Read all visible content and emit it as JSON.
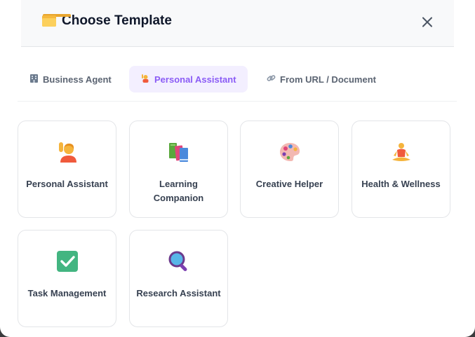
{
  "dialog": {
    "title": "Choose Template",
    "title_icon": "folder-icon",
    "close_icon": "close-icon"
  },
  "tabs": [
    {
      "label": "Business Agent",
      "icon": "office-building-icon",
      "active": false
    },
    {
      "label": "Personal Assistant",
      "icon": "raising-hand-icon",
      "active": true
    },
    {
      "label": "From URL / Document",
      "icon": "link-icon",
      "active": false
    }
  ],
  "templates": [
    {
      "label": "Personal Assistant",
      "icon": "raising-hand-person-icon"
    },
    {
      "label": "Learning Companion",
      "icon": "books-icon"
    },
    {
      "label": "Creative Helper",
      "icon": "artist-palette-icon"
    },
    {
      "label": "Health & Wellness",
      "icon": "meditation-person-icon"
    },
    {
      "label": "Task Management",
      "icon": "check-mark-box-icon"
    },
    {
      "label": "Research Assistant",
      "icon": "magnifying-glass-icon"
    }
  ],
  "colors": {
    "accent": "#8b5cf6",
    "active_tab_bg": "#f3efff",
    "text_dark": "#0f172a"
  }
}
